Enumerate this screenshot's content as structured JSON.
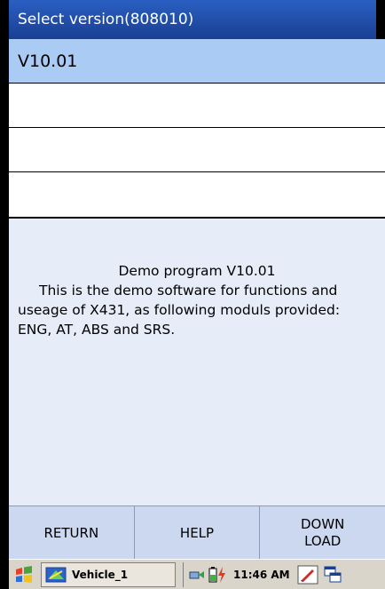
{
  "window": {
    "title": "Select version(808010)"
  },
  "versions": [
    {
      "label": "V10.01",
      "selected": true
    },
    {
      "label": "",
      "selected": false
    },
    {
      "label": "",
      "selected": false
    },
    {
      "label": "",
      "selected": false
    }
  ],
  "info": {
    "heading": "Demo program  V10.01",
    "body": "This is the demo software for functions and useage of X431, as following moduls provided: ENG, AT, ABS and SRS."
  },
  "buttons": {
    "return_label": "RETURN",
    "help_label": "HELP",
    "download_line1": "DOWN",
    "download_line2": "LOAD"
  },
  "taskbar": {
    "task_label": "Vehicle_1",
    "clock": "11:46 AM",
    "icons": [
      "start-flag-icon",
      "vehicle-app-icon",
      "network-icon",
      "battery-icon",
      "pen-icon",
      "window-switch-icon"
    ]
  },
  "colors": {
    "title_bar": "#1a3f93",
    "selected_row": "#a9cbf4",
    "info_bg": "#e7edf8",
    "button_bar": "#ccd8ef",
    "taskbar": "#d9d5cb"
  }
}
